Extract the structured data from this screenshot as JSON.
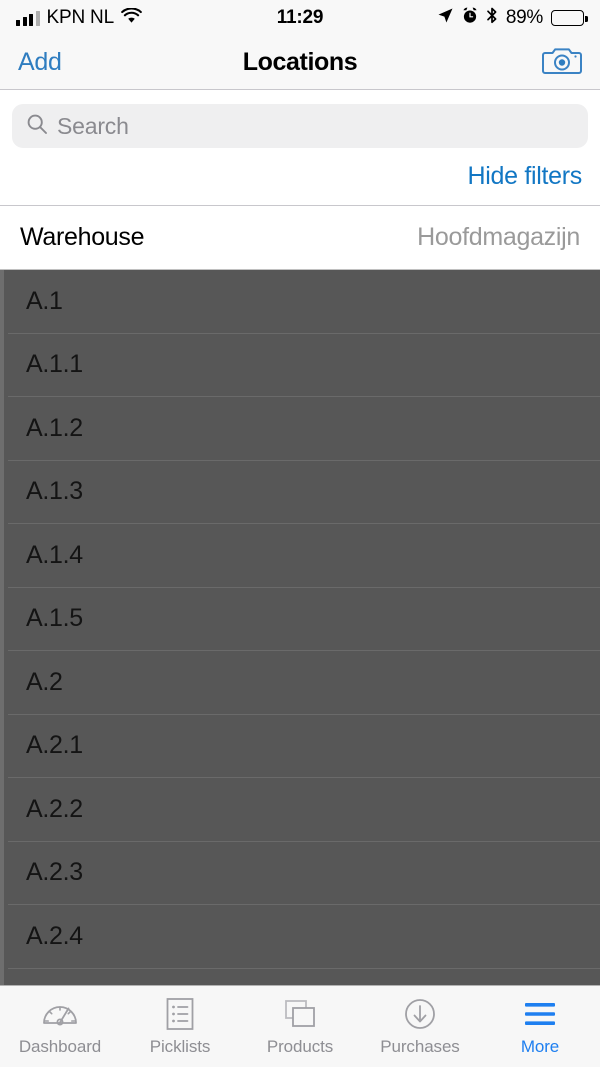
{
  "status_bar": {
    "carrier": "KPN NL",
    "time": "11:29",
    "battery_percent": "89%",
    "icons": [
      "signal-bars-icon",
      "wifi-icon",
      "location-arrow-icon",
      "alarm-clock-icon",
      "bluetooth-icon",
      "battery-icon"
    ]
  },
  "nav_bar": {
    "left_action": "Add",
    "title": "Locations",
    "right_icon": "camera-icon"
  },
  "search": {
    "placeholder": "Search",
    "value": "",
    "icon": "search-icon"
  },
  "filters": {
    "toggle_label": "Hide filters",
    "warehouse_label": "Warehouse",
    "warehouse_value": "Hoofdmagazijn"
  },
  "locations": [
    {
      "name": "A.1"
    },
    {
      "name": "A.1.1"
    },
    {
      "name": "A.1.2"
    },
    {
      "name": "A.1.3"
    },
    {
      "name": "A.1.4"
    },
    {
      "name": "A.1.5"
    },
    {
      "name": "A.2"
    },
    {
      "name": "A.2.1"
    },
    {
      "name": "A.2.2"
    },
    {
      "name": "A.2.3"
    },
    {
      "name": "A.2.4"
    }
  ],
  "tab_bar": {
    "items": [
      {
        "label": "Dashboard",
        "icon": "gauge-icon",
        "active": false
      },
      {
        "label": "Picklists",
        "icon": "list-document-icon",
        "active": false
      },
      {
        "label": "Products",
        "icon": "stacked-squares-icon",
        "active": false
      },
      {
        "label": "Purchases",
        "icon": "arrow-down-circle-icon",
        "active": false
      },
      {
        "label": "More",
        "icon": "hamburger-icon",
        "active": true
      }
    ]
  },
  "colors": {
    "accent_blue": "#1277c4",
    "tab_active_blue": "#1e7ff0",
    "nav_background": "#f8f8f8",
    "dimmed_overlay": "#575757",
    "search_field": "#efeff0",
    "muted_text": "#9a9a9a"
  }
}
